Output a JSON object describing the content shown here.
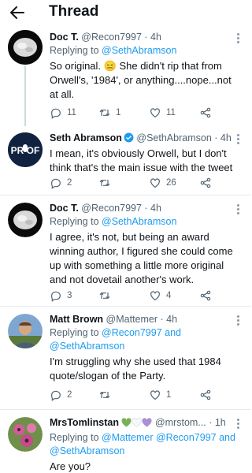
{
  "header": {
    "title": "Thread",
    "back_icon": "arrow-left-icon"
  },
  "tweets": [
    {
      "name": "Doc T.",
      "handle": "@Recon7997",
      "time": "· 4h",
      "replying_prefix": "Replying to",
      "replying_to": "@SethAbramson",
      "text": "So original. 😑 She didn't rip that from Orwell's, '1984', or anything....nope...not at all.",
      "replies": "11",
      "retweets": "1",
      "likes": "11"
    },
    {
      "name": "Seth Abramson",
      "handle": "@SethAbramson",
      "time": "· 4h",
      "verified": true,
      "avatar_text": "PR  OF",
      "text": "I mean, it's obviously Orwell, but I don't think that's the main issue with the tweet",
      "replies": "2",
      "retweets": "",
      "likes": "26"
    },
    {
      "name": "Doc T.",
      "handle": "@Recon7997",
      "time": "· 4h",
      "replying_prefix": "Replying to",
      "replying_to": "@SethAbramson",
      "text": "I agree, it's not, but being an award winning author, I figured she could come up with something a little more original and not dovetail another's work.",
      "replies": "3",
      "retweets": "",
      "likes": "4"
    },
    {
      "name": "Matt Brown",
      "handle": "@Mattemer",
      "time": "· 4h",
      "replying_prefix": "Replying to",
      "replying_to": "@Recon7997 and @SethAbramson",
      "text": "I'm struggling why she used that 1984 quote/slogan of the Party.",
      "replies": "2",
      "retweets": "",
      "likes": "1"
    },
    {
      "name": "MrsTomlinstan",
      "handle": "@mrstom...",
      "time": "· 1h",
      "replying_prefix": "Replying to",
      "replying_to": "@Mattemer @Recon7997 and @SethAbramson",
      "text": "Are you?"
    }
  ],
  "colors": {
    "link": "#1d9bf0",
    "muted": "#536471",
    "green_heart": "#78b159",
    "purple_heart": "#aa8ed6"
  }
}
